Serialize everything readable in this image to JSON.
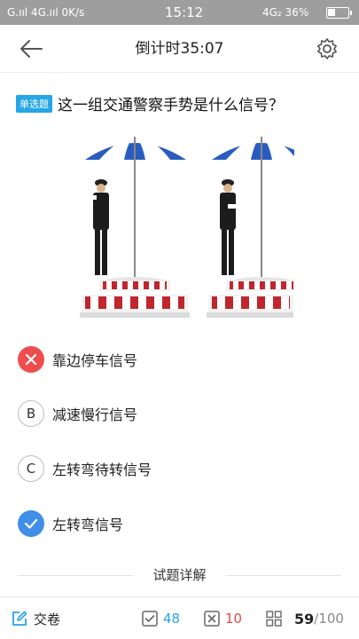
{
  "status_bar": {
    "left": "G.ııl 4G.ııl 0K/s",
    "time": "15:12",
    "right": "4G₂ 36%",
    "battery_level": 0.36
  },
  "header": {
    "title": "倒计时35:07"
  },
  "question": {
    "type_badge": "单选题",
    "text": "这一组交通警察手势是什么信号？"
  },
  "options": [
    {
      "marker": "",
      "state": "wrong",
      "text": "靠边停车信号"
    },
    {
      "marker": "B",
      "state": "normal",
      "text": "减速慢行信号"
    },
    {
      "marker": "C",
      "state": "normal",
      "text": "左转弯待转信号"
    },
    {
      "marker": "",
      "state": "correct",
      "text": "左转弯信号"
    }
  ],
  "detail": {
    "label": "试题详解"
  },
  "bottom_bar": {
    "submit_label": "交卷",
    "correct_count": "48",
    "wrong_count": "10",
    "progress_current": "59",
    "progress_total": "/100"
  },
  "colors": {
    "accent_blue": "#2aa3e6",
    "wrong_red": "#e8464a",
    "correct_blue": "#3f8ee8"
  }
}
